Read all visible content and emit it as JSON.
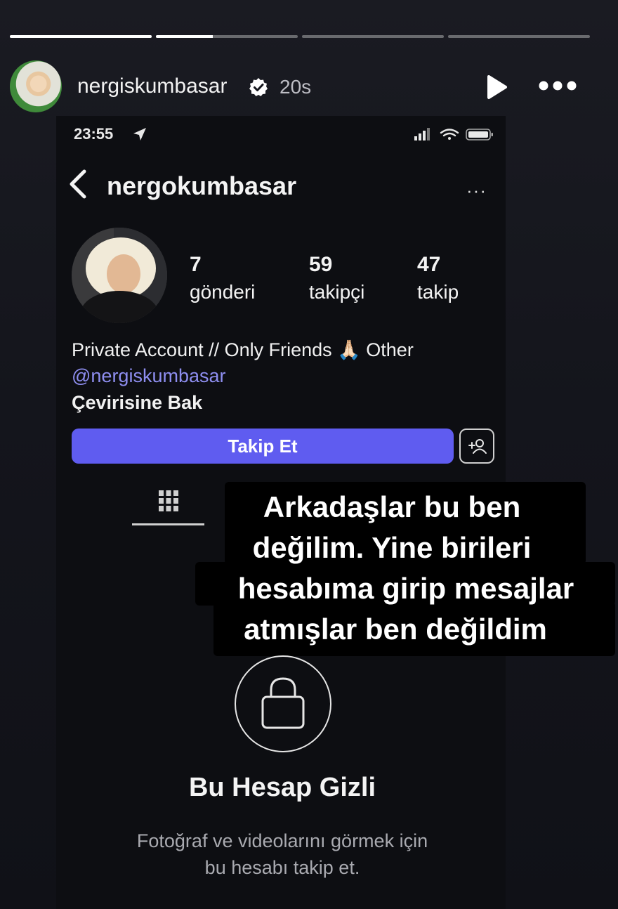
{
  "story": {
    "progress": [
      1,
      0.4,
      0,
      0
    ],
    "username": "nergiskumbasar",
    "time": "20s"
  },
  "phone": {
    "time": "23:55"
  },
  "profile": {
    "username": "nergokumbasar",
    "more": "···",
    "stats": [
      {
        "value": "7",
        "label": "gönderi"
      },
      {
        "value": "59",
        "label": "takipçi"
      },
      {
        "value": "47",
        "label": "takip"
      }
    ],
    "bio": "Private Account // Only Friends 🙏🏻 Other",
    "link": "@nergiskumbasar",
    "translate": "Çevirisine Bak",
    "follow_label": "Takip Et",
    "accent": "#5f5cf0"
  },
  "caption": {
    "lines": [
      "Arkadaşlar bu ben",
      "değilim. Yine birileri",
      "hesabıma girip mesajlar",
      "atmışlar ben değildim"
    ]
  },
  "private": {
    "title": "Bu Hesap Gizli",
    "desc_line1": "Fotoğraf ve videolarını görmek için",
    "desc_line2": "bu hesabı takip et."
  }
}
